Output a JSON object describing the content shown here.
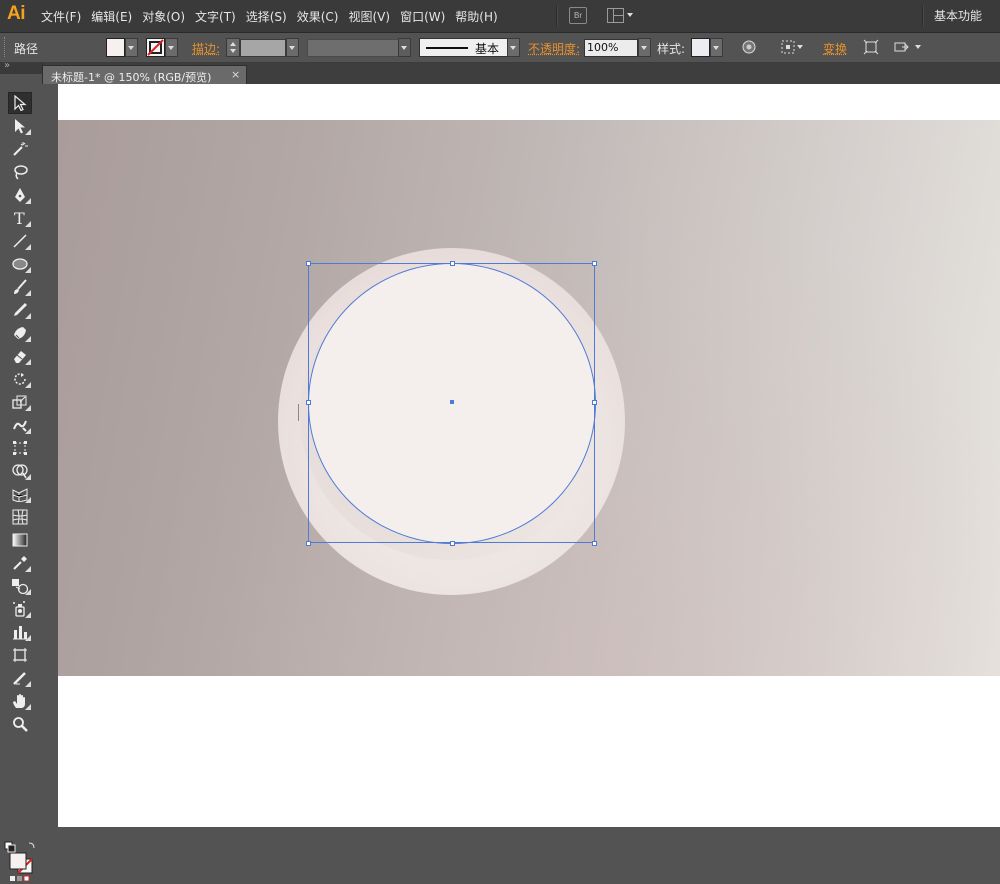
{
  "app": {
    "logo": "Ai",
    "menu": [
      "文件(F)",
      "编辑(E)",
      "对象(O)",
      "文字(T)",
      "选择(S)",
      "效果(C)",
      "视图(V)",
      "窗口(W)",
      "帮助(H)"
    ],
    "bridge_label": "Br",
    "workspace": "基本功能",
    "accent": "#f7a21b"
  },
  "control": {
    "selection_type": "路径",
    "stroke_label": "描边:",
    "stroke_style": "基本",
    "opacity_label": "不透明度:",
    "opacity_value": "100%",
    "style_label": "样式:",
    "transform_label": "变换"
  },
  "document": {
    "tab_label": "未标题-1* @ 150% (RGB/预览)",
    "close": "×"
  },
  "colors": {
    "selection": "#4f7ad6",
    "fill": "#f4efec",
    "panel": "#535353",
    "menubar": "#3a3a3a"
  },
  "tools": [
    "selection-tool",
    "direct-selection-tool",
    "magic-wand-tool",
    "lasso-tool",
    "pen-tool",
    "type-tool",
    "line-segment-tool",
    "ellipse-tool",
    "paintbrush-tool",
    "pencil-tool",
    "blob-brush-tool",
    "eraser-tool",
    "rotate-tool",
    "scale-tool",
    "warp-tool",
    "free-transform-tool",
    "shape-builder-tool",
    "perspective-grid-tool",
    "mesh-tool",
    "gradient-tool",
    "eyedropper-tool",
    "blend-tool",
    "symbol-sprayer-tool",
    "column-graph-tool",
    "artboard-tool",
    "slice-tool",
    "hand-tool",
    "zoom-tool"
  ]
}
